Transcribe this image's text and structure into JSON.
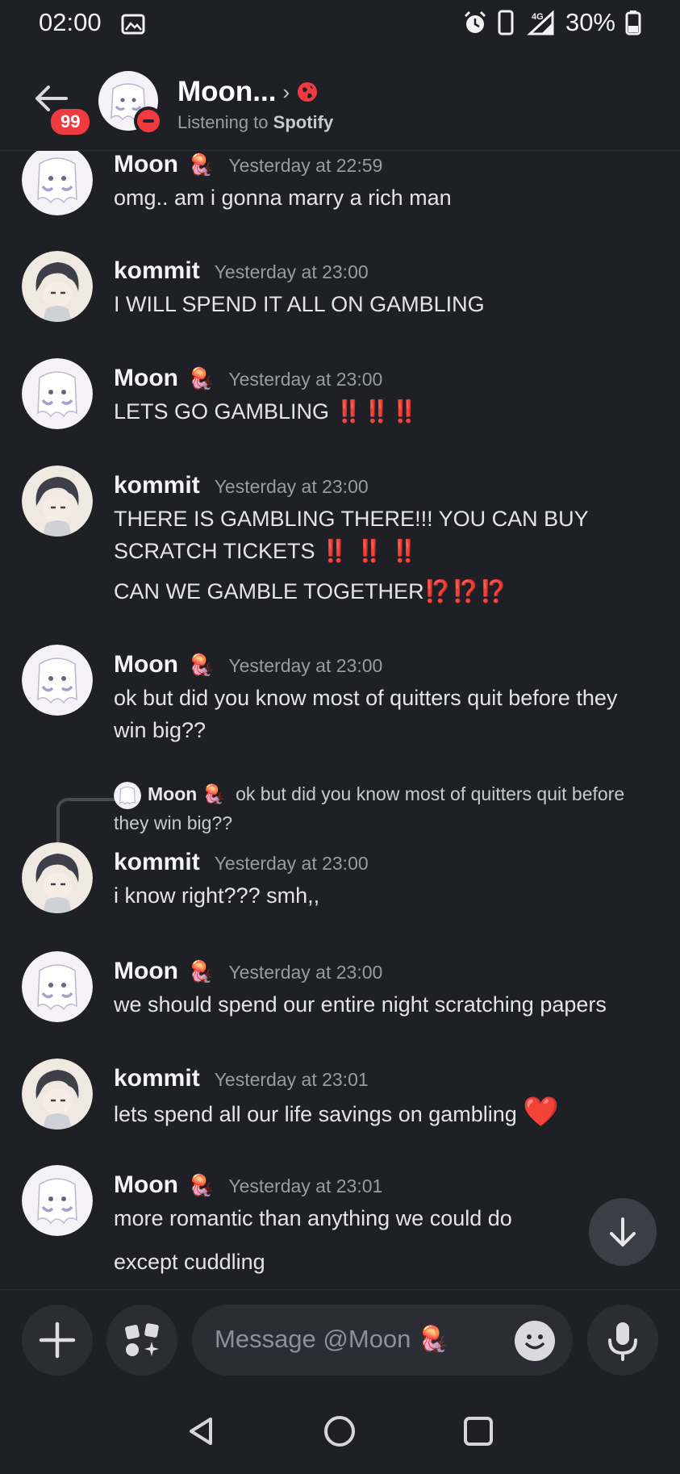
{
  "status_bar": {
    "time": "02:00",
    "network": "4G",
    "battery_percent": "30%"
  },
  "header": {
    "unread_count": "99",
    "name": "Moon...",
    "chevron": "›",
    "status_prefix": "Listening to ",
    "status_app": "Spotify"
  },
  "messages": [
    {
      "author": "Moon",
      "emoji": "🪼",
      "time": "Yesterday at 22:59",
      "lines": [
        "omg.. am i gonna marry a rich man"
      ]
    },
    {
      "author": "kommit",
      "time": "Yesterday at 23:00",
      "lines": [
        "I WILL SPEND IT ALL ON GAMBLING"
      ]
    },
    {
      "author": "Moon",
      "emoji": "🪼",
      "time": "Yesterday at 23:00",
      "text": "LETS GO GAMBLING",
      "marks": "‼️‼️‼️"
    },
    {
      "author": "kommit",
      "time": "Yesterday at 23:00",
      "text1": "THERE IS GAMBLING THERE!!! YOU CAN BUY",
      "text2": "SCRATCH TICKETS",
      "marks2": "‼️ ‼️ ‼️",
      "text3": "CAN WE GAMBLE TOGETHER",
      "marks3": "⁉️⁉️⁉️"
    },
    {
      "author": "Moon",
      "emoji": "🪼",
      "time": "Yesterday at 23:00",
      "lines": [
        "ok but did you know most of quitters quit before they",
        "win big??"
      ]
    },
    {
      "reply_author": "Moon",
      "reply_emoji": "🪼",
      "reply_text": "ok but did you know most of quitters quit before",
      "reply_text2": "they win big??",
      "author": "kommit",
      "time": "Yesterday at 23:00",
      "lines": [
        "i know right??? smh,,"
      ]
    },
    {
      "author": "Moon",
      "emoji": "🪼",
      "time": "Yesterday at 23:00",
      "lines": [
        "we should spend our entire night scratching papers"
      ]
    },
    {
      "author": "kommit",
      "time": "Yesterday at 23:01",
      "text": "lets spend all our life savings on gambling",
      "heart": "❤️"
    },
    {
      "author": "Moon",
      "emoji": "🪼",
      "time": "Yesterday at 23:01",
      "lines": [
        "more romantic than anything we could do",
        "except cuddling"
      ]
    }
  ],
  "composer": {
    "placeholder": "Message @Moon 🪼"
  },
  "icons": [
    "back-arrow-icon",
    "globe-icon",
    "image-icon",
    "alarm-icon",
    "phone-icon",
    "signal-icon",
    "battery-icon",
    "plus-icon",
    "apps-icon",
    "emoji-icon",
    "mic-icon",
    "arrow-down-icon",
    "nav-back-icon",
    "nav-home-icon",
    "nav-recents-icon"
  ],
  "colors": {
    "accent_red": "#ef3b3f",
    "background": "#1f1f26"
  }
}
